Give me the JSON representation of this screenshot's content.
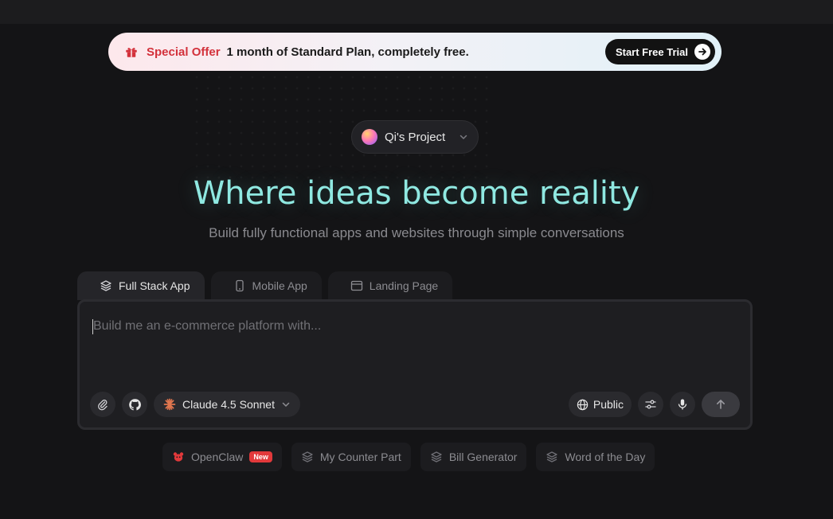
{
  "offer": {
    "label": "Special Offer",
    "message": "1 month of Standard Plan, completely free.",
    "cta": "Start Free Trial",
    "icon": "gift-icon"
  },
  "project": {
    "name": "Qi's Project"
  },
  "hero": {
    "headline": "Where ideas become reality",
    "subline": "Build fully functional apps and websites through simple conversations"
  },
  "tabs": [
    {
      "label": "Full Stack App",
      "icon": "layers-icon",
      "active": true
    },
    {
      "label": "Mobile App",
      "icon": "phone-icon",
      "active": false
    },
    {
      "label": "Landing Page",
      "icon": "browser-icon",
      "active": false
    }
  ],
  "prompt": {
    "placeholder": "Build me an e-commerce platform with...",
    "model": "Claude 4.5 Sonnet",
    "visibility": "Public"
  },
  "suggestions": [
    {
      "label": "OpenClaw",
      "badge": "New",
      "icon": "claw-icon"
    },
    {
      "label": "My Counter Part",
      "icon": "layers-icon"
    },
    {
      "label": "Bill Generator",
      "icon": "layers-icon"
    },
    {
      "label": "Word of the Day",
      "icon": "layers-icon"
    }
  ],
  "colors": {
    "accent_headline": "#8fe8e1",
    "offer_label": "#d3313b",
    "new_badge": "#e2393b"
  }
}
